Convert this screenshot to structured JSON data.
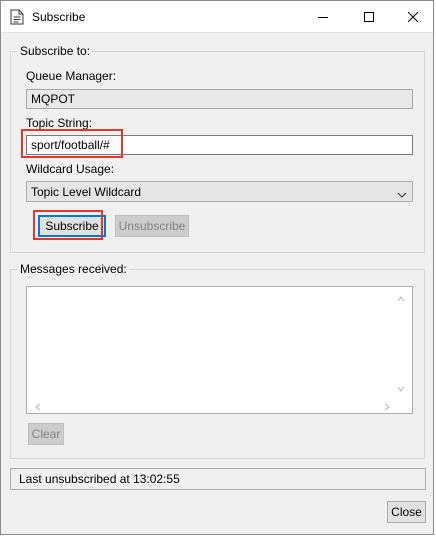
{
  "window": {
    "title": "Subscribe"
  },
  "subscribe_group": {
    "label": "Subscribe to:",
    "queue_manager_label": "Queue Manager:",
    "queue_manager_value": "MQPOT",
    "topic_string_label": "Topic String:",
    "topic_string_value": "sport/football/#",
    "wildcard_usage_label": "Wildcard Usage:",
    "wildcard_usage_selected": "Topic Level Wildcard",
    "subscribe_button": "Subscribe",
    "unsubscribe_button": "Unsubscribe"
  },
  "messages_group": {
    "label": "Messages received:",
    "clear_button": "Clear"
  },
  "status": {
    "text": "Last unsubscribed at 13:02:55"
  },
  "footer": {
    "close_button": "Close"
  },
  "colors": {
    "highlight": "#e0392b",
    "focus": "#0078d7"
  }
}
